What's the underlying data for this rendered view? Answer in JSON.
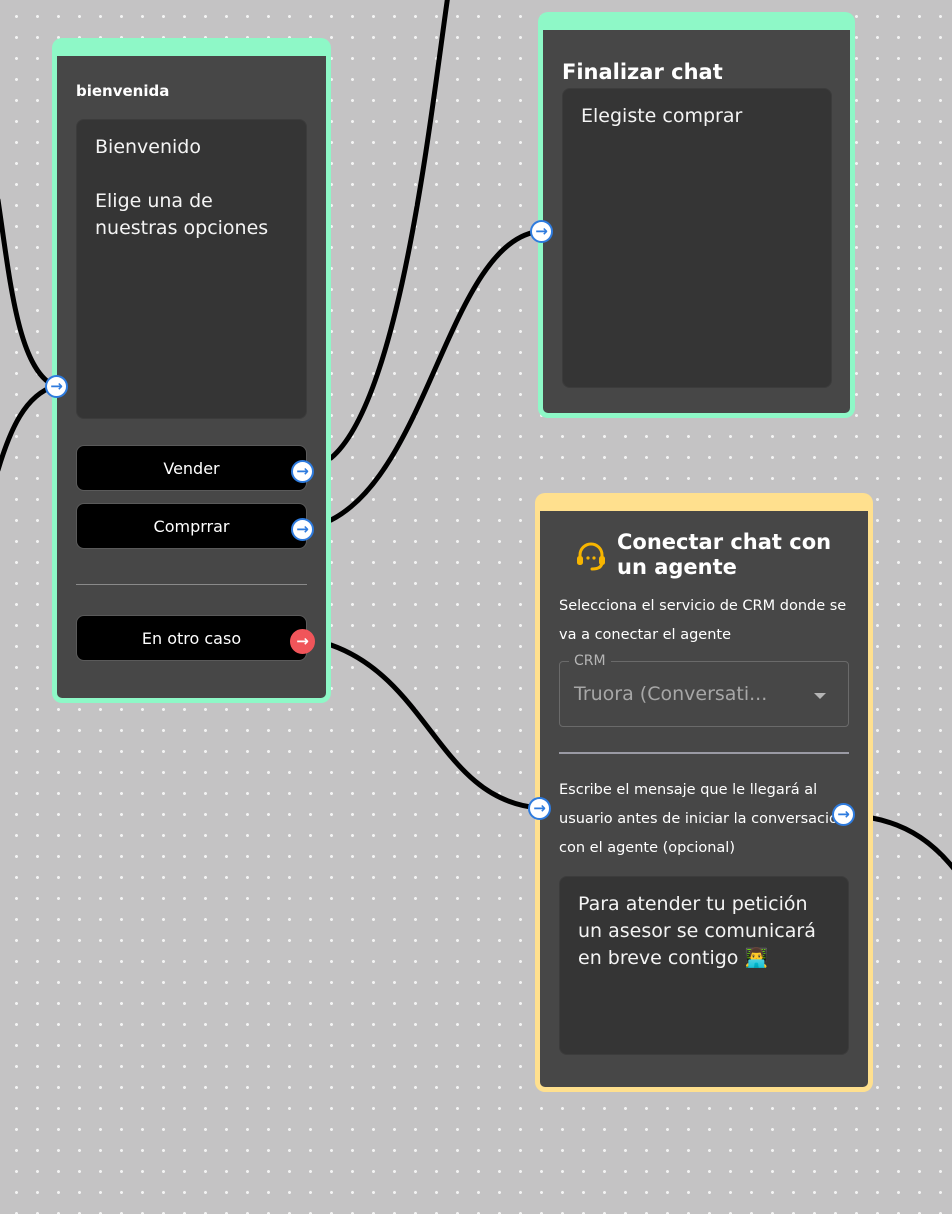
{
  "nodes": {
    "bienvenida": {
      "title": "bienvenida",
      "message": "Bienvenido\n\nElige una de nuestras opciones",
      "options": [
        "Vender",
        "Comprrar"
      ],
      "fallback_label": "En otro caso"
    },
    "finalizar": {
      "title": "Finalizar chat",
      "message": "Elegiste comprar"
    },
    "agente": {
      "title": "Conectar chat con un agente",
      "crm_helper": "Selecciona el servicio de CRM donde se va a conectar el agente",
      "crm_label": "CRM",
      "crm_value": "Truora (Conversati...",
      "message_helper": "Escribe el mensaje que le llegará al\nusuario antes de iniciar la conversación\ncon el agente (opcional)",
      "message": "Para atender tu petición un asesor se comunicará en breve contigo 👨‍💻"
    }
  },
  "colors": {
    "canvas": "#c4c3c4",
    "node_body": "#474747",
    "node_border_green": "#8ef8c7",
    "node_border_yellow": "#ffe08e",
    "handle_blue": "#2e7bde",
    "handle_red": "#f0555a",
    "icon_accent": "#f7b500"
  },
  "icons": {
    "handle": "arrow-right-circle-icon",
    "agent": "headset-icon",
    "crm_dropdown": "caret-down-icon"
  }
}
